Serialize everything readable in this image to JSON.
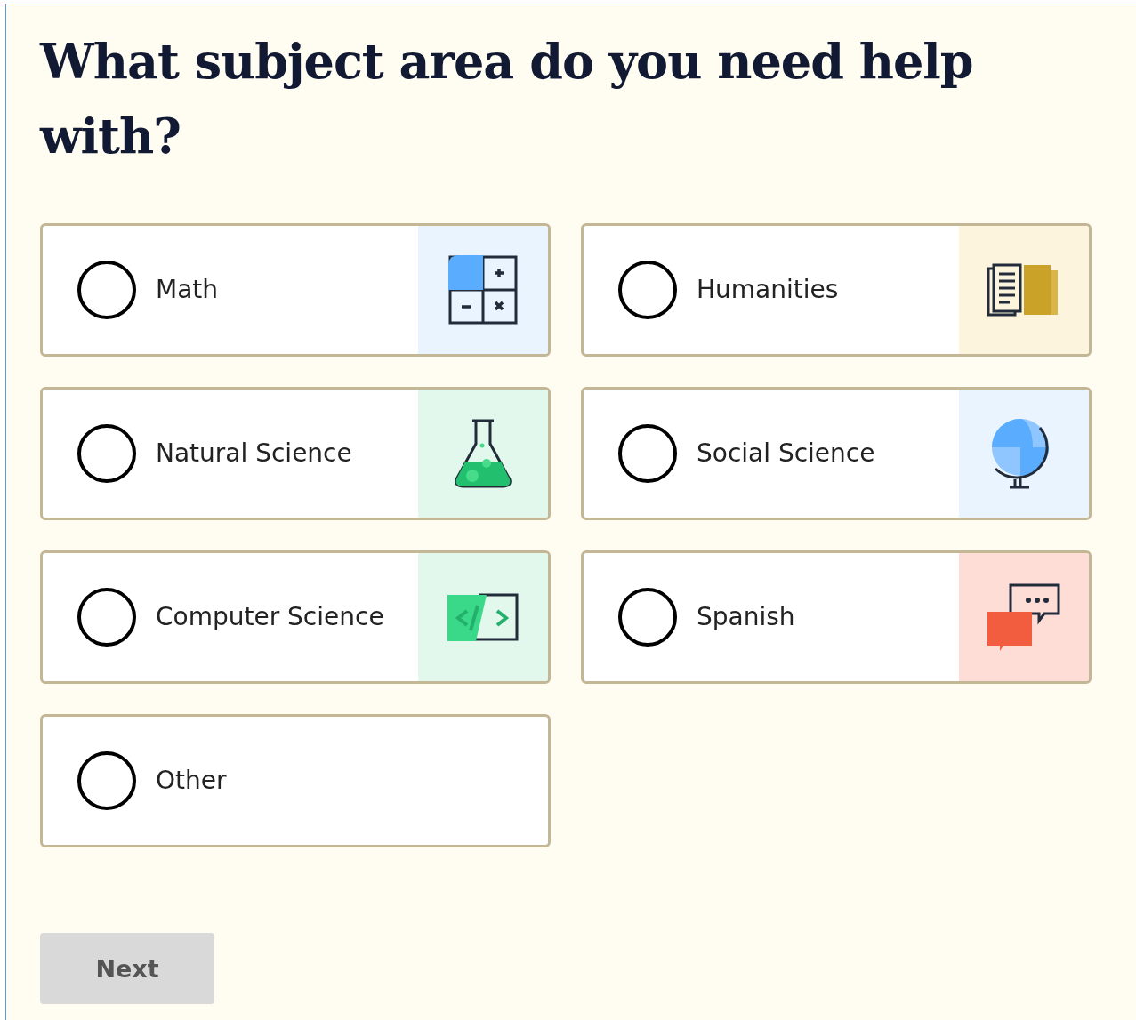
{
  "title": "What subject area do you need help with?",
  "options": [
    {
      "label": "Math",
      "selected": false,
      "kind": "math"
    },
    {
      "label": "Humanities",
      "selected": false,
      "kind": "humanities"
    },
    {
      "label": "Natural Science",
      "selected": false,
      "kind": "natural-science"
    },
    {
      "label": "Social Science",
      "selected": false,
      "kind": "social-science"
    },
    {
      "label": "Computer Science",
      "selected": false,
      "kind": "computer-science"
    },
    {
      "label": "Spanish",
      "selected": false,
      "kind": "language"
    },
    {
      "label": "Other",
      "selected": false,
      "kind": "other"
    }
  ],
  "next_button": {
    "label": "Next",
    "disabled": true
  }
}
